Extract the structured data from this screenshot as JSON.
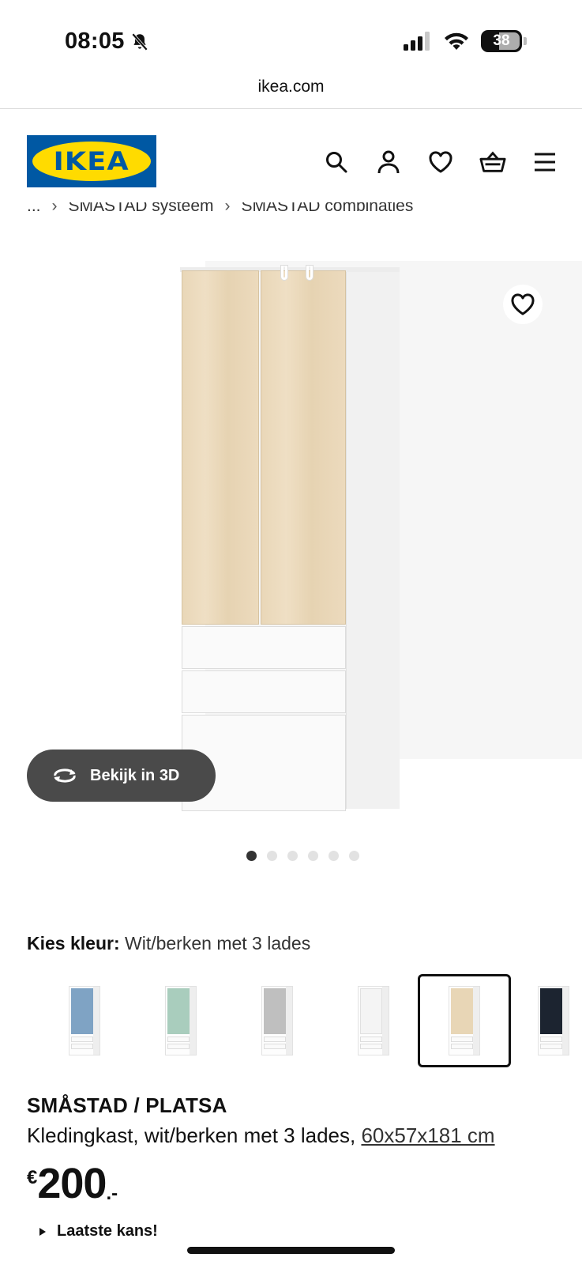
{
  "status_bar": {
    "time": "08:05",
    "battery": "38"
  },
  "browser": {
    "url": "ikea.com"
  },
  "header": {
    "logo_text": "IKEA",
    "icons": [
      "search-icon",
      "user-icon",
      "heart-icon",
      "basket-icon",
      "menu-icon"
    ]
  },
  "breadcrumb": {
    "items": [
      "...",
      "SMÅSTAD systeem",
      "SMÅSTAD combinaties"
    ]
  },
  "gallery": {
    "view3d_label": "Bekijk in 3D",
    "image_count": 6,
    "active_index": 0
  },
  "colour": {
    "label": "Kies kleur:",
    "value": "Wit/berken met 3 lades",
    "swatches": [
      {
        "name": "blue",
        "door": "#7fa3c4"
      },
      {
        "name": "mint",
        "door": "#a9cdbd"
      },
      {
        "name": "grey",
        "door": "#bfbfbf"
      },
      {
        "name": "white",
        "door": "#f4f4f4"
      },
      {
        "name": "birch",
        "door": "#e8d6b6",
        "selected": true
      },
      {
        "name": "black",
        "door": "#1c2430"
      }
    ]
  },
  "product": {
    "name": "SMÅSTAD / PLATSA",
    "description": "Kledingkast, wit/berken met 3 lades, ",
    "dimensions": "60x57x181 cm",
    "price_currency": "€",
    "price_amount": "200",
    "price_decimal": ".-",
    "last_chance": "Laatste kans!"
  },
  "colors": {
    "ikea_blue": "#0058a3",
    "ikea_yellow": "#ffdb00",
    "button_dark": "#4a4a4a"
  }
}
